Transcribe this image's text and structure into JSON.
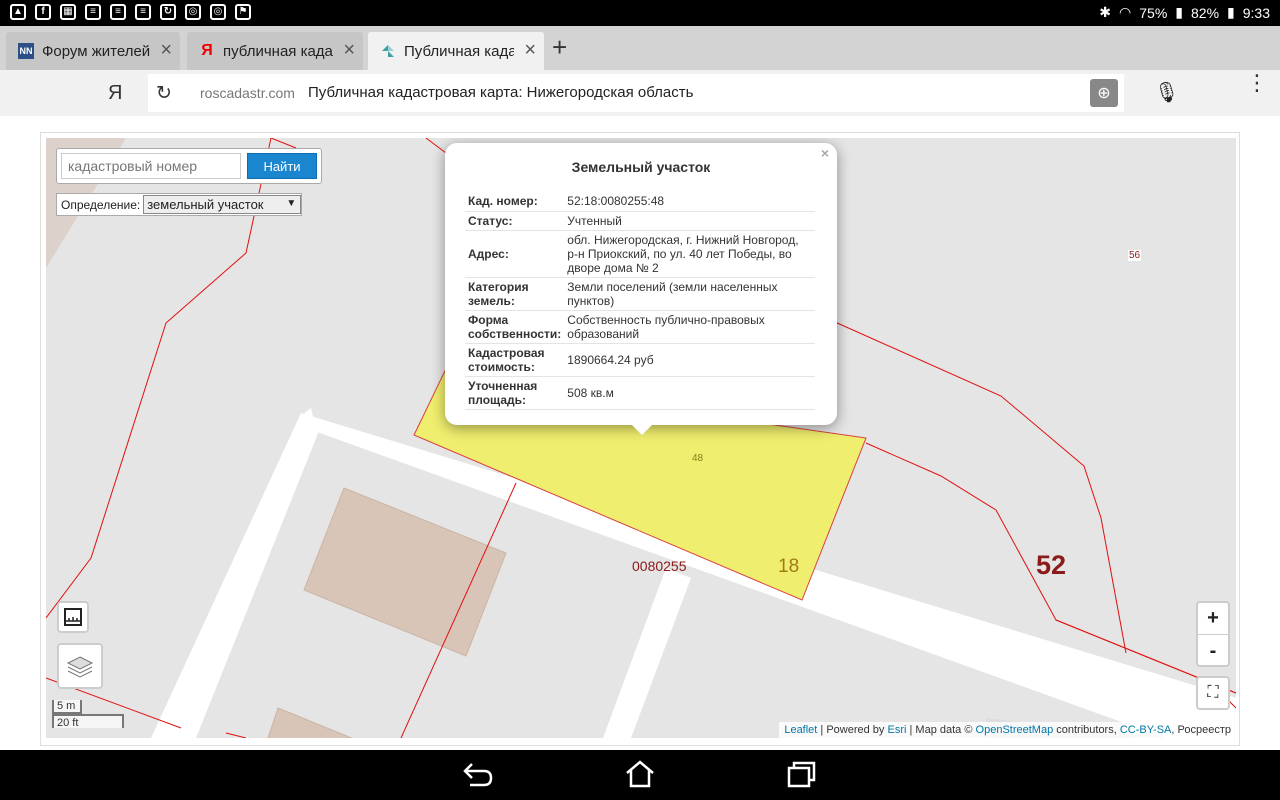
{
  "status_bar": {
    "battery1": "75%",
    "battery2": "82%",
    "time": "9:33"
  },
  "tabs": [
    {
      "title": "Форум жителей",
      "favicon": "NN",
      "active": false
    },
    {
      "title": "публичная када",
      "favicon": "Я",
      "active": false
    },
    {
      "title": "Публичная када",
      "favicon": "map-logo",
      "active": true
    }
  ],
  "omnibox": {
    "engine_label": "Я",
    "domain": "roscadastr.com",
    "title": "Публичная кадастровая карта: Нижегородская область"
  },
  "search": {
    "placeholder": "кадастровый номер",
    "button_label": "Найти",
    "definition_label": "Определение:",
    "definition_value": "земельный участок"
  },
  "popup": {
    "title": "Земельный участок",
    "close": "×",
    "rows": [
      {
        "key": "Кад. номер",
        "value": "52:18:0080255:48"
      },
      {
        "key": "Статус",
        "value": "Учтенный"
      },
      {
        "key": "Адрес",
        "value": "обл. Нижегородская, г. Нижний Новгород, р-н Приокский, по ул. 40 лет Победы, во дворе дома № 2"
      },
      {
        "key": "Категория земель",
        "value": "Земли поселений (земли населенных пунктов)"
      },
      {
        "key": "Форма собственности",
        "value": "Собственность публично-правовых образований"
      },
      {
        "key": "Кадастровая стоимость",
        "value": "1890664.24 руб"
      },
      {
        "key": "Уточненная площадь",
        "value": "508 кв.м"
      }
    ]
  },
  "map_labels": {
    "parcel_48": "48",
    "parcel_56": "56",
    "block": "0080255",
    "district": "18",
    "region": "52"
  },
  "zoom": {
    "in": "+",
    "out": "-"
  },
  "scale": {
    "metric": "5 m",
    "imperial": "20 ft"
  },
  "attribution": {
    "leaflet": "Leaflet",
    "powered": "| Powered by",
    "esri": "Esri",
    "mapdata": "| Map data ©",
    "osm": "OpenStreetMap",
    "contrib": "contributors,",
    "license": "CC-BY-SA",
    "rosreestr": ", Росреестр"
  },
  "colors": {
    "parcel_fill": "#f0ee6e",
    "boundary": "#e01010",
    "button": "#1a86d0"
  }
}
